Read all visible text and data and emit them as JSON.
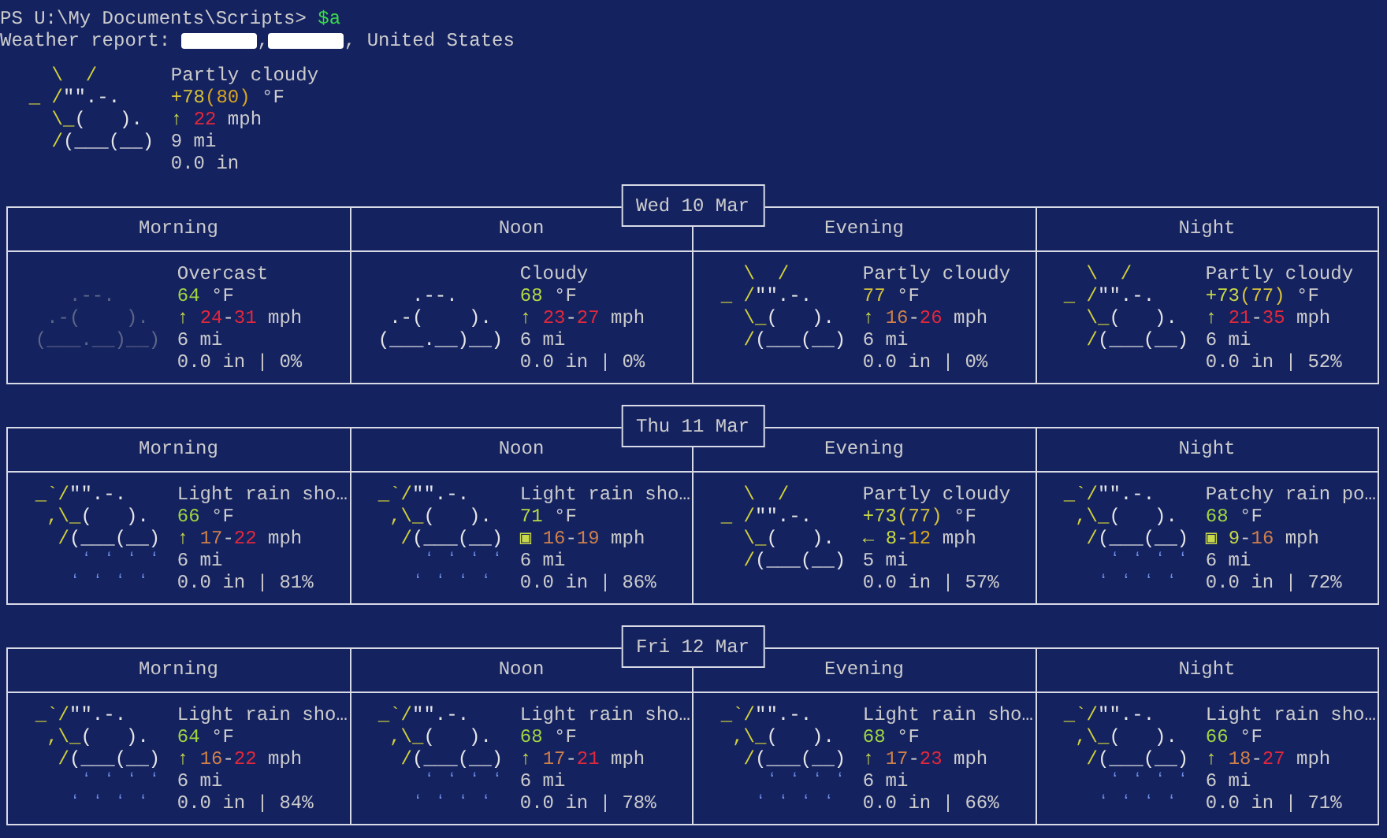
{
  "prompt": {
    "path": "PS U:\\My Documents\\Scripts>",
    "command": "$a"
  },
  "report": {
    "label": "Weather report:",
    "parts": [
      {
        "kind": "redacted"
      },
      {
        "kind": "text",
        "text": ","
      },
      {
        "kind": "redacted"
      },
      {
        "kind": "text",
        "text": ", United States"
      }
    ]
  },
  "current": {
    "icon": {
      "kind": "partly_cloudy",
      "lines": [
        [
          {
            "text": "    \\  /",
            "color": "#d2d13a"
          }
        ],
        [
          {
            "text": "  _ /",
            "color": "#d2d13a"
          },
          {
            "text": "\"\".-.",
            "color": "#e6e6e6"
          }
        ],
        [
          {
            "text": "    \\_",
            "color": "#d2d13a"
          },
          {
            "text": "(   ).",
            "color": "#e6e6e6"
          }
        ],
        [
          {
            "text": "    /",
            "color": "#d2d13a"
          },
          {
            "text": "(___(__)",
            "color": "#e6e6e6"
          }
        ]
      ]
    },
    "condition": "Partly cloudy",
    "temperature": [
      {
        "text": "+78",
        "color": "#d7c23a"
      },
      {
        "text": "(80)",
        "color": "#d7a51f"
      },
      {
        "text": " °F"
      }
    ],
    "wind": [
      {
        "text": "↑ ",
        "color": "#c8d84a"
      },
      {
        "text": "22",
        "color": "#e0283c"
      },
      {
        "text": " mph"
      }
    ],
    "visibility": "9 mi",
    "precipitation": "0.0 in"
  },
  "days": [
    {
      "date": "Wed 10 Mar",
      "periods": [
        {
          "label": "Morning",
          "icon": {
            "kind": "cloudy",
            "lines": [
              [
                {
                  "text": "     .--.",
                  "color": "#5d6686"
                }
              ],
              [
                {
                  "text": "   .-(    ).",
                  "color": "#5d6686"
                }
              ],
              [
                {
                  "text": "  (___.__)__)",
                  "color": "#5d6686"
                }
              ]
            ]
          },
          "condition": "Overcast",
          "temperature": [
            {
              "text": "64",
              "color": "#9fd441"
            },
            {
              "text": " °F"
            }
          ],
          "wind": [
            {
              "text": "↑ ",
              "color": "#c8d84a"
            },
            {
              "text": "24",
              "color": "#e0283c"
            },
            {
              "text": "-"
            },
            {
              "text": "31",
              "color": "#e0283c"
            },
            {
              "text": " mph"
            }
          ],
          "visibility": "6 mi",
          "precipitation": "0.0 in | 0%"
        },
        {
          "label": "Noon",
          "icon": {
            "kind": "cloudy",
            "lines": [
              [
                {
                  "text": "     .--.",
                  "color": "#e6e6e6"
                }
              ],
              [
                {
                  "text": "   .-(    ).",
                  "color": "#e6e6e6"
                }
              ],
              [
                {
                  "text": "  (___.__)__)",
                  "color": "#e6e6e6"
                }
              ]
            ]
          },
          "condition": "Cloudy",
          "temperature": [
            {
              "text": "68",
              "color": "#b4d845"
            },
            {
              "text": " °F"
            }
          ],
          "wind": [
            {
              "text": "↑ ",
              "color": "#c8d84a"
            },
            {
              "text": "23",
              "color": "#e0283c"
            },
            {
              "text": "-"
            },
            {
              "text": "27",
              "color": "#e0283c"
            },
            {
              "text": " mph"
            }
          ],
          "visibility": "6 mi",
          "precipitation": "0.0 in | 0%"
        },
        {
          "label": "Evening",
          "icon": {
            "kind": "partly_cloudy",
            "lines": [
              [
                {
                  "text": "    \\  /",
                  "color": "#d2d13a"
                }
              ],
              [
                {
                  "text": "  _ /",
                  "color": "#d2d13a"
                },
                {
                  "text": "\"\".-.",
                  "color": "#e6e6e6"
                }
              ],
              [
                {
                  "text": "    \\_",
                  "color": "#d2d13a"
                },
                {
                  "text": "(   ).",
                  "color": "#e6e6e6"
                }
              ],
              [
                {
                  "text": "    /",
                  "color": "#d2d13a"
                },
                {
                  "text": "(___(__)",
                  "color": "#e6e6e6"
                }
              ]
            ]
          },
          "condition": "Partly cloudy",
          "temperature": [
            {
              "text": "77",
              "color": "#d7c23a"
            },
            {
              "text": " °F"
            }
          ],
          "wind": [
            {
              "text": "↑ ",
              "color": "#c8d84a"
            },
            {
              "text": "16",
              "color": "#d0804a"
            },
            {
              "text": "-"
            },
            {
              "text": "26",
              "color": "#e0283c"
            },
            {
              "text": " mph"
            }
          ],
          "visibility": "6 mi",
          "precipitation": "0.0 in | 0%"
        },
        {
          "label": "Night",
          "icon": {
            "kind": "partly_cloudy",
            "lines": [
              [
                {
                  "text": "    \\  /",
                  "color": "#d2d13a"
                }
              ],
              [
                {
                  "text": "  _ /",
                  "color": "#d2d13a"
                },
                {
                  "text": "\"\".-.",
                  "color": "#e6e6e6"
                }
              ],
              [
                {
                  "text": "    \\_",
                  "color": "#d2d13a"
                },
                {
                  "text": "(   ).",
                  "color": "#e6e6e6"
                }
              ],
              [
                {
                  "text": "    /",
                  "color": "#d2d13a"
                },
                {
                  "text": "(___(__)",
                  "color": "#e6e6e6"
                }
              ]
            ]
          },
          "condition": "Partly cloudy",
          "temperature": [
            {
              "text": "+73",
              "color": "#c8d845"
            },
            {
              "text": "(77)",
              "color": "#d7c23a"
            },
            {
              "text": " °F"
            }
          ],
          "wind": [
            {
              "text": "↑ ",
              "color": "#c8d84a"
            },
            {
              "text": "21",
              "color": "#e0283c"
            },
            {
              "text": "-"
            },
            {
              "text": "35",
              "color": "#e0283c"
            },
            {
              "text": " mph"
            }
          ],
          "visibility": "6 mi",
          "precipitation": "0.0 in | 52%"
        }
      ]
    },
    {
      "date": "Thu 11 Mar",
      "periods": [
        {
          "label": "Morning",
          "icon": {
            "kind": "rain",
            "lines": [
              [
                {
                  "text": "  _`/",
                  "color": "#d2d13a"
                },
                {
                  "text": "\"\".-.",
                  "color": "#e6e6e6"
                }
              ],
              [
                {
                  "text": "   ,\\_",
                  "color": "#d2d13a"
                },
                {
                  "text": "(   ).",
                  "color": "#e6e6e6"
                }
              ],
              [
                {
                  "text": "    /",
                  "color": "#d2d13a"
                },
                {
                  "text": "(___(__)",
                  "color": "#e6e6e6"
                }
              ],
              [
                {
                  "text": "      ʻ ʻ ʻ ʻ",
                  "color": "#6f8fe8"
                }
              ],
              [
                {
                  "text": "     ʻ ʻ ʻ ʻ",
                  "color": "#6f8fe8"
                }
              ]
            ]
          },
          "condition": "Light rain sho…",
          "temperature": [
            {
              "text": "66",
              "color": "#9fd441"
            },
            {
              "text": " °F"
            }
          ],
          "wind": [
            {
              "text": "↑ ",
              "color": "#c8d84a"
            },
            {
              "text": "17",
              "color": "#d0804a"
            },
            {
              "text": "-"
            },
            {
              "text": "22",
              "color": "#e0283c"
            },
            {
              "text": " mph"
            }
          ],
          "visibility": "6 mi",
          "precipitation": "0.0 in | 81%"
        },
        {
          "label": "Noon",
          "icon": {
            "kind": "rain",
            "lines": [
              [
                {
                  "text": "  _`/",
                  "color": "#d2d13a"
                },
                {
                  "text": "\"\".-.",
                  "color": "#e6e6e6"
                }
              ],
              [
                {
                  "text": "   ,\\_",
                  "color": "#d2d13a"
                },
                {
                  "text": "(   ).",
                  "color": "#e6e6e6"
                }
              ],
              [
                {
                  "text": "    /",
                  "color": "#d2d13a"
                },
                {
                  "text": "(___(__)",
                  "color": "#e6e6e6"
                }
              ],
              [
                {
                  "text": "      ʻ ʻ ʻ ʻ",
                  "color": "#6f8fe8"
                }
              ],
              [
                {
                  "text": "     ʻ ʻ ʻ ʻ",
                  "color": "#6f8fe8"
                }
              ]
            ]
          },
          "condition": "Light rain sho…",
          "temperature": [
            {
              "text": "71",
              "color": "#b4d845"
            },
            {
              "text": " °F"
            }
          ],
          "wind": [
            {
              "text": "▣ ",
              "color": "#c8d84a"
            },
            {
              "text": "16",
              "color": "#d0804a"
            },
            {
              "text": "-"
            },
            {
              "text": "19",
              "color": "#d0804a"
            },
            {
              "text": " mph"
            }
          ],
          "visibility": "6 mi",
          "precipitation": "0.0 in | 86%"
        },
        {
          "label": "Evening",
          "icon": {
            "kind": "partly_cloudy",
            "lines": [
              [
                {
                  "text": "    \\  /",
                  "color": "#d2d13a"
                }
              ],
              [
                {
                  "text": "  _ /",
                  "color": "#d2d13a"
                },
                {
                  "text": "\"\".-.",
                  "color": "#e6e6e6"
                }
              ],
              [
                {
                  "text": "    \\_",
                  "color": "#d2d13a"
                },
                {
                  "text": "(   ).",
                  "color": "#e6e6e6"
                }
              ],
              [
                {
                  "text": "    /",
                  "color": "#d2d13a"
                },
                {
                  "text": "(___(__)",
                  "color": "#e6e6e6"
                }
              ]
            ]
          },
          "condition": "Partly cloudy",
          "temperature": [
            {
              "text": "+73",
              "color": "#c8d845"
            },
            {
              "text": "(77)",
              "color": "#d7c23a"
            },
            {
              "text": " °F"
            }
          ],
          "wind": [
            {
              "text": "← ",
              "color": "#c8d84a"
            },
            {
              "text": "8",
              "color": "#c8d845"
            },
            {
              "text": "-"
            },
            {
              "text": "12",
              "color": "#d7a51f"
            },
            {
              "text": " mph"
            }
          ],
          "visibility": "5 mi",
          "precipitation": "0.0 in | 57%"
        },
        {
          "label": "Night",
          "icon": {
            "kind": "rain",
            "lines": [
              [
                {
                  "text": "  _`/",
                  "color": "#d2d13a"
                },
                {
                  "text": "\"\".-.",
                  "color": "#e6e6e6"
                }
              ],
              [
                {
                  "text": "   ,\\_",
                  "color": "#d2d13a"
                },
                {
                  "text": "(   ).",
                  "color": "#e6e6e6"
                }
              ],
              [
                {
                  "text": "    /",
                  "color": "#d2d13a"
                },
                {
                  "text": "(___(__)",
                  "color": "#e6e6e6"
                }
              ],
              [
                {
                  "text": "      ʻ ʻ ʻ ʻ",
                  "color": "#6f8fe8"
                }
              ],
              [
                {
                  "text": "     ʻ ʻ ʻ ʻ",
                  "color": "#6f8fe8"
                }
              ]
            ]
          },
          "condition": "Patchy rain po…",
          "temperature": [
            {
              "text": "68",
              "color": "#9fd441"
            },
            {
              "text": " °F"
            }
          ],
          "wind": [
            {
              "text": "▣ ",
              "color": "#c8d84a"
            },
            {
              "text": "9",
              "color": "#c8d845"
            },
            {
              "text": "-"
            },
            {
              "text": "16",
              "color": "#d0804a"
            },
            {
              "text": " mph"
            }
          ],
          "visibility": "6 mi",
          "precipitation": "0.0 in | 72%"
        }
      ]
    },
    {
      "date": "Fri 12 Mar",
      "periods": [
        {
          "label": "Morning",
          "icon": {
            "kind": "rain",
            "lines": [
              [
                {
                  "text": "  _`/",
                  "color": "#d2d13a"
                },
                {
                  "text": "\"\".-.",
                  "color": "#e6e6e6"
                }
              ],
              [
                {
                  "text": "   ,\\_",
                  "color": "#d2d13a"
                },
                {
                  "text": "(   ).",
                  "color": "#e6e6e6"
                }
              ],
              [
                {
                  "text": "    /",
                  "color": "#d2d13a"
                },
                {
                  "text": "(___(__)",
                  "color": "#e6e6e6"
                }
              ],
              [
                {
                  "text": "      ʻ ʻ ʻ ʻ",
                  "color": "#6f8fe8"
                }
              ],
              [
                {
                  "text": "     ʻ ʻ ʻ ʻ",
                  "color": "#6f8fe8"
                }
              ]
            ]
          },
          "condition": "Light rain sho…",
          "temperature": [
            {
              "text": "64",
              "color": "#9fd441"
            },
            {
              "text": " °F"
            }
          ],
          "wind": [
            {
              "text": "↑ ",
              "color": "#c8d84a"
            },
            {
              "text": "16",
              "color": "#d0804a"
            },
            {
              "text": "-"
            },
            {
              "text": "22",
              "color": "#e0283c"
            },
            {
              "text": " mph"
            }
          ],
          "visibility": "6 mi",
          "precipitation": "0.0 in | 84%"
        },
        {
          "label": "Noon",
          "icon": {
            "kind": "rain",
            "lines": [
              [
                {
                  "text": "  _`/",
                  "color": "#d2d13a"
                },
                {
                  "text": "\"\".-.",
                  "color": "#e6e6e6"
                }
              ],
              [
                {
                  "text": "   ,\\_",
                  "color": "#d2d13a"
                },
                {
                  "text": "(   ).",
                  "color": "#e6e6e6"
                }
              ],
              [
                {
                  "text": "    /",
                  "color": "#d2d13a"
                },
                {
                  "text": "(___(__)",
                  "color": "#e6e6e6"
                }
              ],
              [
                {
                  "text": "      ʻ ʻ ʻ ʻ",
                  "color": "#6f8fe8"
                }
              ],
              [
                {
                  "text": "     ʻ ʻ ʻ ʻ",
                  "color": "#6f8fe8"
                }
              ]
            ]
          },
          "condition": "Light rain sho…",
          "temperature": [
            {
              "text": "68",
              "color": "#9fd441"
            },
            {
              "text": " °F"
            }
          ],
          "wind": [
            {
              "text": "↑ ",
              "color": "#c8d84a"
            },
            {
              "text": "17",
              "color": "#d0804a"
            },
            {
              "text": "-"
            },
            {
              "text": "21",
              "color": "#e0283c"
            },
            {
              "text": " mph"
            }
          ],
          "visibility": "6 mi",
          "precipitation": "0.0 in | 78%"
        },
        {
          "label": "Evening",
          "icon": {
            "kind": "rain",
            "lines": [
              [
                {
                  "text": "  _`/",
                  "color": "#d2d13a"
                },
                {
                  "text": "\"\".-.",
                  "color": "#e6e6e6"
                }
              ],
              [
                {
                  "text": "   ,\\_",
                  "color": "#d2d13a"
                },
                {
                  "text": "(   ).",
                  "color": "#e6e6e6"
                }
              ],
              [
                {
                  "text": "    /",
                  "color": "#d2d13a"
                },
                {
                  "text": "(___(__)",
                  "color": "#e6e6e6"
                }
              ],
              [
                {
                  "text": "      ʻ ʻ ʻ ʻ",
                  "color": "#6f8fe8"
                }
              ],
              [
                {
                  "text": "     ʻ ʻ ʻ ʻ",
                  "color": "#6f8fe8"
                }
              ]
            ]
          },
          "condition": "Light rain sho…",
          "temperature": [
            {
              "text": "68",
              "color": "#9fd441"
            },
            {
              "text": " °F"
            }
          ],
          "wind": [
            {
              "text": "↑ ",
              "color": "#c8d84a"
            },
            {
              "text": "17",
              "color": "#d0804a"
            },
            {
              "text": "-"
            },
            {
              "text": "23",
              "color": "#e0283c"
            },
            {
              "text": " mph"
            }
          ],
          "visibility": "6 mi",
          "precipitation": "0.0 in | 66%"
        },
        {
          "label": "Night",
          "icon": {
            "kind": "rain",
            "lines": [
              [
                {
                  "text": "  _`/",
                  "color": "#d2d13a"
                },
                {
                  "text": "\"\".-.",
                  "color": "#e6e6e6"
                }
              ],
              [
                {
                  "text": "   ,\\_",
                  "color": "#d2d13a"
                },
                {
                  "text": "(   ).",
                  "color": "#e6e6e6"
                }
              ],
              [
                {
                  "text": "    /",
                  "color": "#d2d13a"
                },
                {
                  "text": "(___(__)",
                  "color": "#e6e6e6"
                }
              ],
              [
                {
                  "text": "      ʻ ʻ ʻ ʻ",
                  "color": "#6f8fe8"
                }
              ],
              [
                {
                  "text": "     ʻ ʻ ʻ ʻ",
                  "color": "#6f8fe8"
                }
              ]
            ]
          },
          "condition": "Light rain sho…",
          "temperature": [
            {
              "text": "66",
              "color": "#9fd441"
            },
            {
              "text": " °F"
            }
          ],
          "wind": [
            {
              "text": "↑ ",
              "color": "#c8d84a"
            },
            {
              "text": "18",
              "color": "#d0804a"
            },
            {
              "text": "-"
            },
            {
              "text": "27",
              "color": "#e0283c"
            },
            {
              "text": " mph"
            }
          ],
          "visibility": "6 mi",
          "precipitation": "0.0 in | 71%"
        }
      ]
    }
  ]
}
